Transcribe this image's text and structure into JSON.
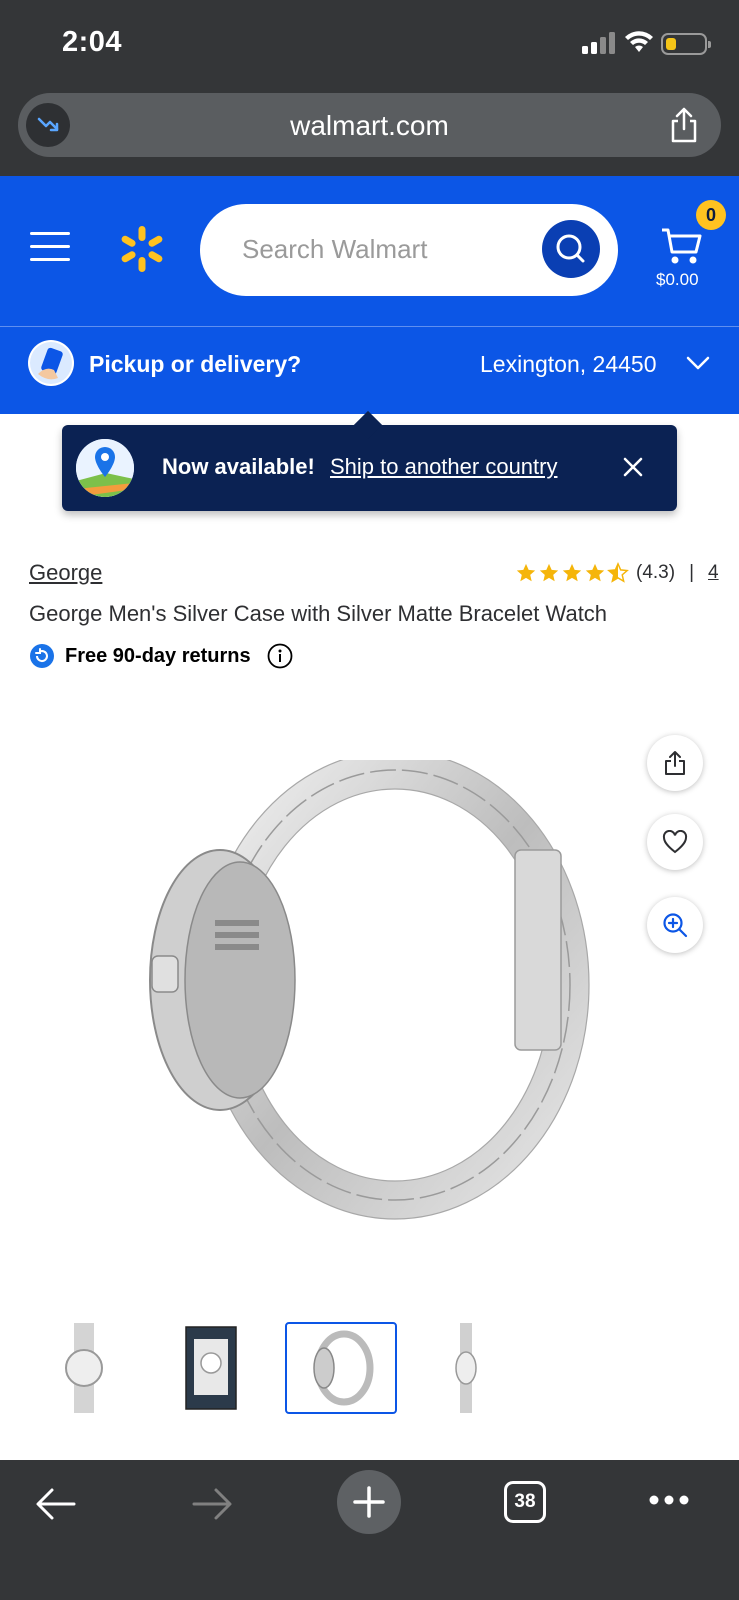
{
  "status_bar": {
    "time": "2:04"
  },
  "browser": {
    "url": "walmart.com",
    "tab_count": "38"
  },
  "header": {
    "search_placeholder": "Search Walmart",
    "cart_count": "0",
    "cart_total": "$0.00"
  },
  "pickup_bar": {
    "label": "Pickup or delivery?",
    "location": "Lexington, 24450"
  },
  "tooltip": {
    "bold": "Now available!",
    "link": "Ship to another country"
  },
  "product": {
    "brand": "George",
    "rating": "(4.3)",
    "separator": "|",
    "review_count": "4",
    "stars": 4.3,
    "title": "George Men's Silver Case with Silver Matte Bracelet Watch",
    "returns": "Free 90-day returns"
  },
  "colors": {
    "walmart_blue": "#0c56e6",
    "spark_yellow": "#ffc220",
    "dark_navy": "#0b2253",
    "browser_chrome": "#343638"
  },
  "thumbnails": [
    {
      "name": "watch-front",
      "selected": false
    },
    {
      "name": "watch-in-box",
      "selected": false
    },
    {
      "name": "watch-side",
      "selected": true
    },
    {
      "name": "watch-standing",
      "selected": false
    }
  ]
}
